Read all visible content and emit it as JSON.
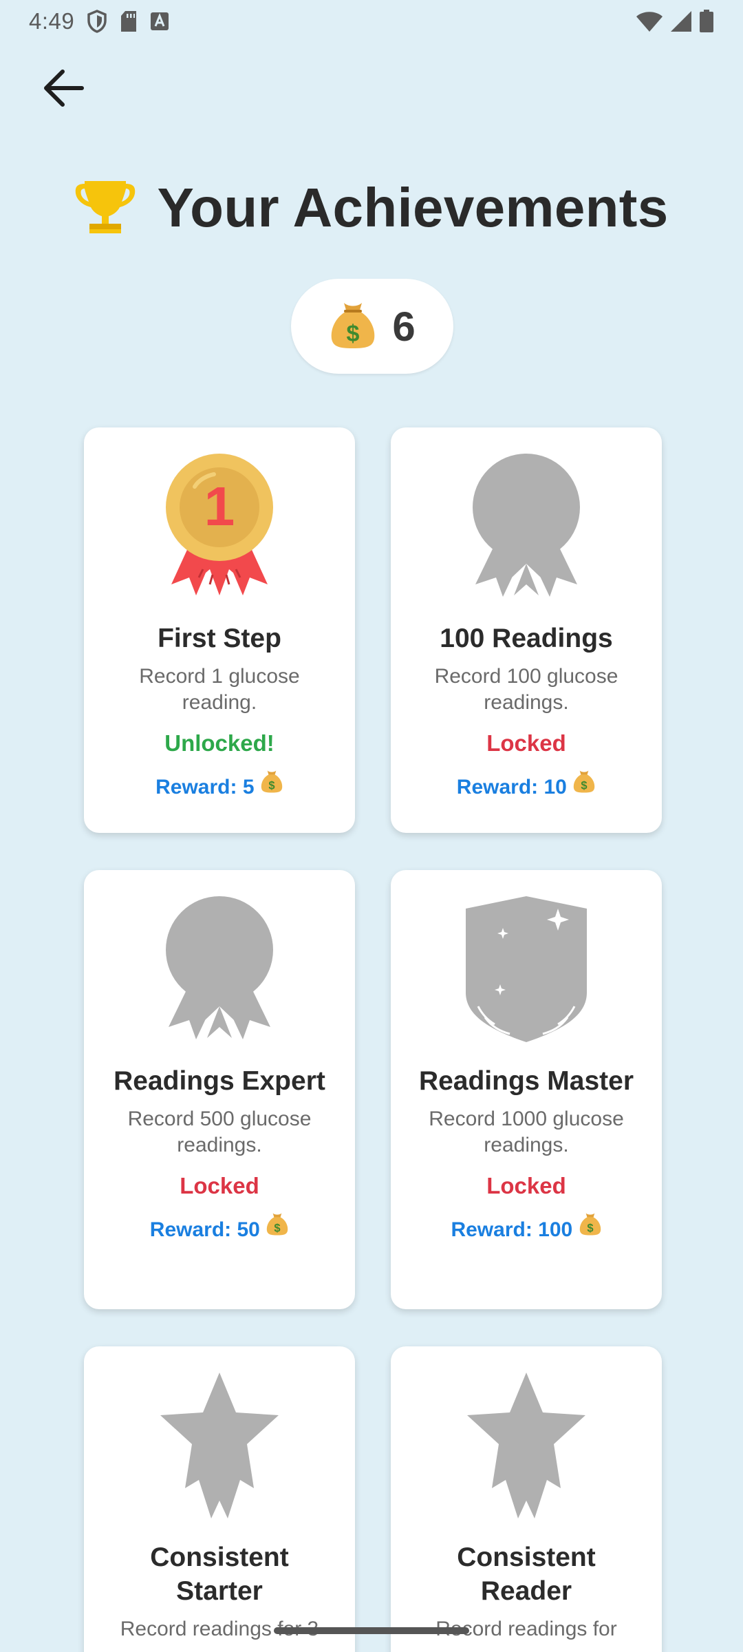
{
  "status_bar": {
    "time": "4:49",
    "left_icons": [
      "shield-icon",
      "sd-card-icon",
      "keyboard-a-icon"
    ],
    "right_icons": [
      "wifi-icon",
      "signal-icon",
      "battery-icon"
    ]
  },
  "header": {
    "back_icon": "arrow-left-icon",
    "title_icon": "trophy-icon",
    "title": "Your Achievements"
  },
  "coins": {
    "icon": "money-bag-icon",
    "count": "6"
  },
  "achievements": [
    {
      "title": "First Step",
      "description": "Record 1 glucose reading.",
      "status": "Unlocked!",
      "reward": "Reward: 5",
      "unlocked": true,
      "medal": "gold-medal-1-icon"
    },
    {
      "title": "100 Readings",
      "description": "Record 100 glucose readings.",
      "status": "Locked",
      "reward": "Reward: 10",
      "unlocked": false,
      "medal": "locked-medal-icon"
    },
    {
      "title": "Readings Expert",
      "description": "Record 500 glucose readings.",
      "status": "Locked",
      "reward": "Reward: 50",
      "unlocked": false,
      "medal": "locked-medal-icon"
    },
    {
      "title": "Readings Master",
      "description": "Record 1000 glucose readings.",
      "status": "Locked",
      "reward": "Reward: 100",
      "unlocked": false,
      "medal": "locked-shield-icon"
    },
    {
      "title": "Consistent Starter",
      "description": "Record readings for 3",
      "status": "",
      "reward": "",
      "unlocked": false,
      "medal": "locked-star-icon"
    },
    {
      "title": "Consistent Reader",
      "description": "Record readings for",
      "status": "",
      "reward": "",
      "unlocked": false,
      "medal": "locked-star-icon"
    }
  ],
  "colors": {
    "background": "#dfeff6",
    "unlocked": "#2da84a",
    "locked": "#dc3545",
    "reward": "#1a7fe0",
    "locked_icon": "#b0b0b0"
  }
}
